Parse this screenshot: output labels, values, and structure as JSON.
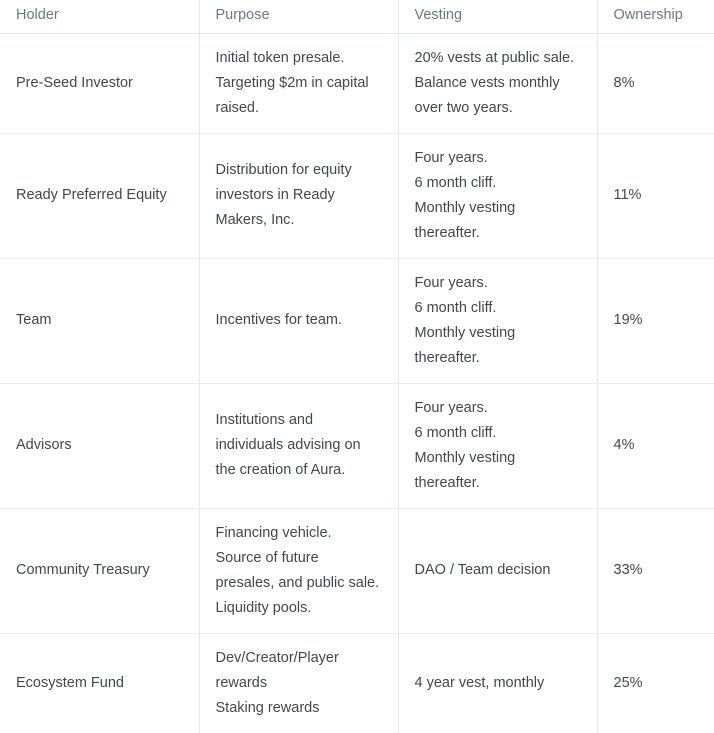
{
  "table": {
    "name": "token-allocation-table",
    "columns": [
      {
        "key": "holder",
        "label": "Holder"
      },
      {
        "key": "purpose",
        "label": "Purpose"
      },
      {
        "key": "vesting",
        "label": "Vesting"
      },
      {
        "key": "ownership",
        "label": "Ownership"
      }
    ],
    "rows": [
      {
        "holder": "Pre-Seed Investor",
        "purpose": [
          "Initial token presale. Targeting $2m in capital raised."
        ],
        "vesting": [
          "20% vests at public sale.",
          "Balance vests monthly over two years."
        ],
        "ownership": "8%"
      },
      {
        "holder": "Ready Preferred Equity",
        "purpose": [
          "Distribution for equity investors in Ready Makers, Inc."
        ],
        "vesting": [
          "Four years.",
          "6 month cliff.",
          "Monthly vesting thereafter."
        ],
        "ownership": "11%"
      },
      {
        "holder": "Team",
        "purpose": [
          "Incentives for team."
        ],
        "vesting": [
          "Four years.",
          "6 month cliff.",
          "Monthly vesting thereafter."
        ],
        "ownership": "19%"
      },
      {
        "holder": "Advisors",
        "purpose": [
          "Institutions and individuals advising on the creation of Aura."
        ],
        "vesting": [
          "Four years.",
          "6 month cliff.",
          "Monthly vesting thereafter."
        ],
        "ownership": "4%"
      },
      {
        "holder": "Community Treasury",
        "purpose": [
          "Financing vehicle. Source of future presales, and public sale. Liquidity pools."
        ],
        "vesting": [
          "DAO / Team decision"
        ],
        "ownership": "33%"
      },
      {
        "holder": "Ecosystem Fund",
        "purpose": [
          "Dev/Creator/Player rewards",
          "Staking rewards"
        ],
        "vesting": [
          "4 year vest, monthly"
        ],
        "ownership": "25%"
      }
    ]
  },
  "colors": {
    "header_text": "#6b7785",
    "body_text": "#41474f",
    "border": "#e3e8ef",
    "row_border": "#e9edf2",
    "background": "#ffffff"
  }
}
